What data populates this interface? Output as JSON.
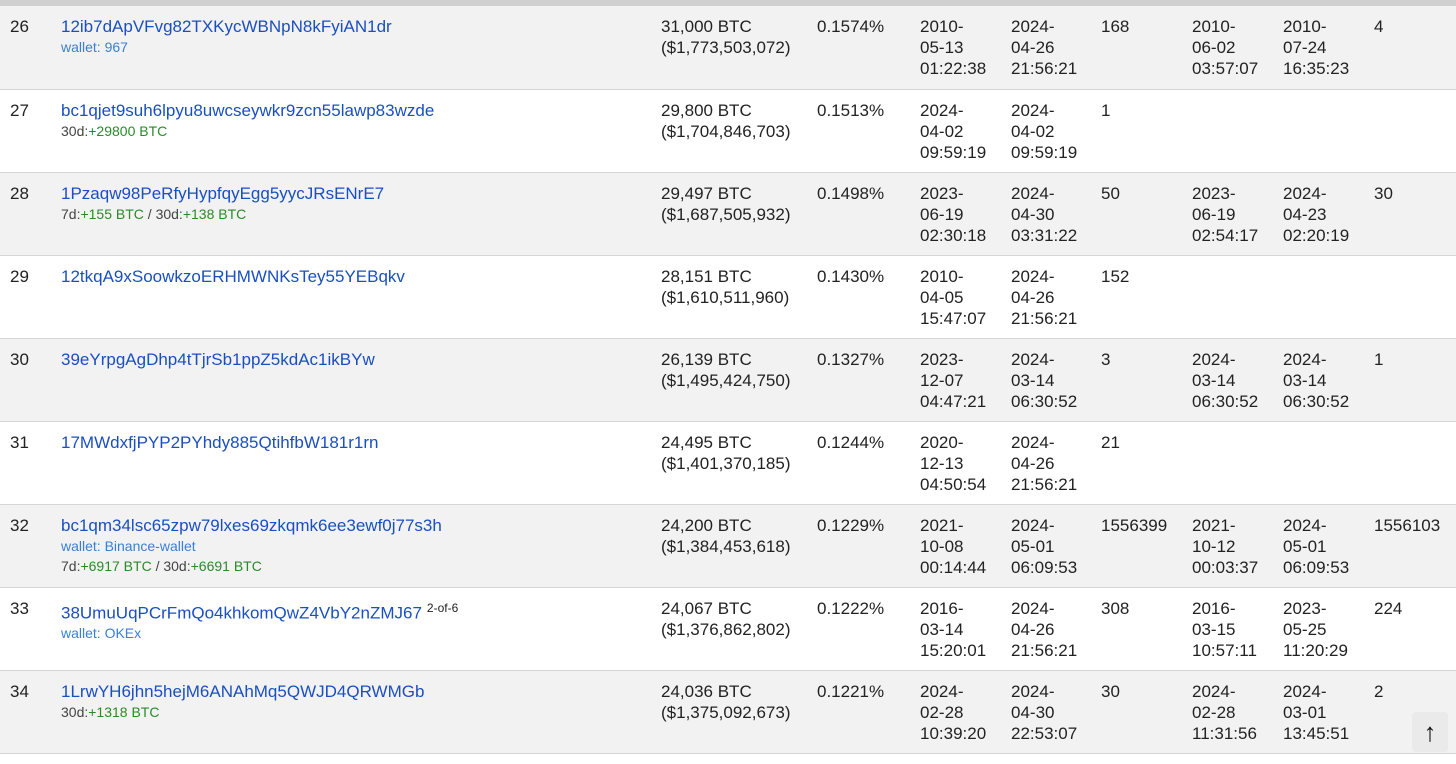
{
  "rows": [
    {
      "rank": "26",
      "address": "12ib7dApVFvg82TXKycWBNpN8kFyiAN1dr",
      "signature": "",
      "wallet": "wallet: 967",
      "changes": [],
      "balance_btc": "31,000 BTC",
      "balance_usd": "($1,773,503,072)",
      "percent": "0.1574%",
      "first_in_date": "2010-",
      "first_in_day": "05-13",
      "first_in_time": "01:22:38",
      "last_in_date": "2024-",
      "last_in_day": "04-26",
      "last_in_time": "21:56:21",
      "ins": "168",
      "first_out_date": "2010-",
      "first_out_day": "06-02",
      "first_out_time": "03:57:07",
      "last_out_date": "2010-",
      "last_out_day": "07-24",
      "last_out_time": "16:35:23",
      "outs": "4"
    },
    {
      "rank": "27",
      "address": "bc1qjet9suh6lpyu8uwcseywkr9zcn55lawp83wzde",
      "signature": "",
      "wallet": "",
      "changes": [
        {
          "label": "30d:",
          "value": "+29800 BTC"
        }
      ],
      "balance_btc": "29,800 BTC",
      "balance_usd": "($1,704,846,703)",
      "percent": "0.1513%",
      "first_in_date": "2024-",
      "first_in_day": "04-02",
      "first_in_time": "09:59:19",
      "last_in_date": "2024-",
      "last_in_day": "04-02",
      "last_in_time": "09:59:19",
      "ins": "1",
      "first_out_date": "",
      "first_out_day": "",
      "first_out_time": "",
      "last_out_date": "",
      "last_out_day": "",
      "last_out_time": "",
      "outs": ""
    },
    {
      "rank": "28",
      "address": "1Pzaqw98PeRfyHypfqyEgg5yycJRsENrE7",
      "signature": "",
      "wallet": "",
      "changes": [
        {
          "label": "7d:",
          "value": "+155 BTC"
        },
        {
          "label": "30d:",
          "value": "+138 BTC"
        }
      ],
      "balance_btc": "29,497 BTC",
      "balance_usd": "($1,687,505,932)",
      "percent": "0.1498%",
      "first_in_date": "2023-",
      "first_in_day": "06-19",
      "first_in_time": "02:30:18",
      "last_in_date": "2024-",
      "last_in_day": "04-30",
      "last_in_time": "03:31:22",
      "ins": "50",
      "first_out_date": "2023-",
      "first_out_day": "06-19",
      "first_out_time": "02:54:17",
      "last_out_date": "2024-",
      "last_out_day": "04-23",
      "last_out_time": "02:20:19",
      "outs": "30"
    },
    {
      "rank": "29",
      "address": "12tkqA9xSoowkzoERHMWNKsTey55YEBqkv",
      "signature": "",
      "wallet": "",
      "changes": [],
      "balance_btc": "28,151 BTC",
      "balance_usd": "($1,610,511,960)",
      "percent": "0.1430%",
      "first_in_date": "2010-",
      "first_in_day": "04-05",
      "first_in_time": "15:47:07",
      "last_in_date": "2024-",
      "last_in_day": "04-26",
      "last_in_time": "21:56:21",
      "ins": "152",
      "first_out_date": "",
      "first_out_day": "",
      "first_out_time": "",
      "last_out_date": "",
      "last_out_day": "",
      "last_out_time": "",
      "outs": ""
    },
    {
      "rank": "30",
      "address": "39eYrpgAgDhp4tTjrSb1ppZ5kdAc1ikBYw",
      "signature": "",
      "wallet": "",
      "changes": [],
      "balance_btc": "26,139 BTC",
      "balance_usd": "($1,495,424,750)",
      "percent": "0.1327%",
      "first_in_date": "2023-",
      "first_in_day": "12-07",
      "first_in_time": "04:47:21",
      "last_in_date": "2024-",
      "last_in_day": "03-14",
      "last_in_time": "06:30:52",
      "ins": "3",
      "first_out_date": "2024-",
      "first_out_day": "03-14",
      "first_out_time": "06:30:52",
      "last_out_date": "2024-",
      "last_out_day": "03-14",
      "last_out_time": "06:30:52",
      "outs": "1"
    },
    {
      "rank": "31",
      "address": "17MWdxfjPYP2PYhdy885QtihfbW181r1rn",
      "signature": "",
      "wallet": "",
      "changes": [],
      "balance_btc": "24,495 BTC",
      "balance_usd": "($1,401,370,185)",
      "percent": "0.1244%",
      "first_in_date": "2020-",
      "first_in_day": "12-13",
      "first_in_time": "04:50:54",
      "last_in_date": "2024-",
      "last_in_day": "04-26",
      "last_in_time": "21:56:21",
      "ins": "21",
      "first_out_date": "",
      "first_out_day": "",
      "first_out_time": "",
      "last_out_date": "",
      "last_out_day": "",
      "last_out_time": "",
      "outs": ""
    },
    {
      "rank": "32",
      "address": "bc1qm34lsc65zpw79lxes69zkqmk6ee3ewf0j77s3h",
      "signature": "",
      "wallet": "wallet: Binance-wallet",
      "changes": [
        {
          "label": "7d:",
          "value": "+6917 BTC"
        },
        {
          "label": "30d:",
          "value": "+6691 BTC"
        }
      ],
      "balance_btc": "24,200 BTC",
      "balance_usd": "($1,384,453,618)",
      "percent": "0.1229%",
      "first_in_date": "2021-",
      "first_in_day": "10-08",
      "first_in_time": "00:14:44",
      "last_in_date": "2024-",
      "last_in_day": "05-01",
      "last_in_time": "06:09:53",
      "ins": "1556399",
      "first_out_date": "2021-",
      "first_out_day": "10-12",
      "first_out_time": "00:03:37",
      "last_out_date": "2024-",
      "last_out_day": "05-01",
      "last_out_time": "06:09:53",
      "outs": "1556103"
    },
    {
      "rank": "33",
      "address": "38UmuUqPCrFmQo4khkomQwZ4VbY2nZMJ67",
      "signature": "2-of-6",
      "wallet": "wallet: OKEx",
      "changes": [],
      "balance_btc": "24,067 BTC",
      "balance_usd": "($1,376,862,802)",
      "percent": "0.1222%",
      "first_in_date": "2016-",
      "first_in_day": "03-14",
      "first_in_time": "15:20:01",
      "last_in_date": "2024-",
      "last_in_day": "04-26",
      "last_in_time": "21:56:21",
      "ins": "308",
      "first_out_date": "2016-",
      "first_out_day": "03-15",
      "first_out_time": "10:57:11",
      "last_out_date": "2023-",
      "last_out_day": "05-25",
      "last_out_time": "11:20:29",
      "outs": "224"
    },
    {
      "rank": "34",
      "address": "1LrwYH6jhn5hejM6ANAhMq5QWJD4QRWMGb",
      "signature": "",
      "wallet": "",
      "changes": [
        {
          "label": "30d:",
          "value": "+1318 BTC"
        }
      ],
      "balance_btc": "24,036 BTC",
      "balance_usd": "($1,375,092,673)",
      "percent": "0.1221%",
      "first_in_date": "2024-",
      "first_in_day": "02-28",
      "first_in_time": "10:39:20",
      "last_in_date": "2024-",
      "last_in_day": "04-30",
      "last_in_time": "22:53:07",
      "ins": "30",
      "first_out_date": "2024-",
      "first_out_day": "02-28",
      "first_out_time": "11:31:56",
      "last_out_date": "2024-",
      "last_out_day": "03-01",
      "last_out_time": "13:45:51",
      "outs": "2"
    }
  ],
  "scroll_top": {
    "glyph": "↑"
  },
  "colors": {
    "link": "#1a4fc0",
    "wallet": "#3a7fd5",
    "positive": "#2a8a2a",
    "stripe": "#f2f2f2"
  }
}
